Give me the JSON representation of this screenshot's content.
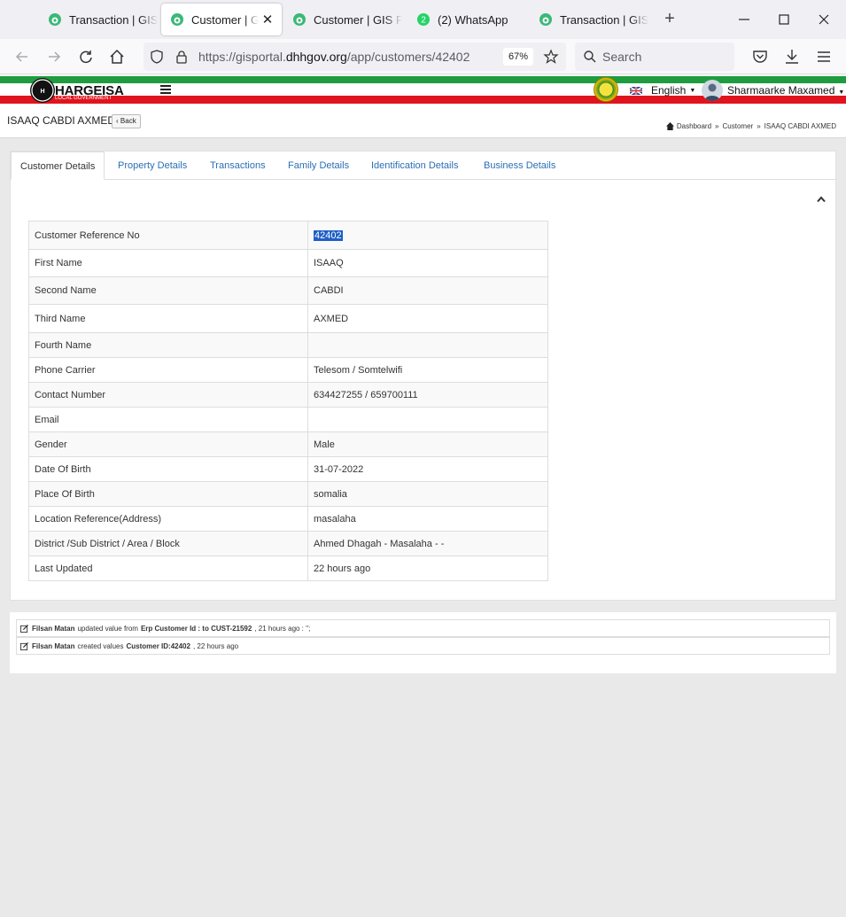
{
  "browser": {
    "tabs": [
      {
        "title": "Transaction | GIS P"
      },
      {
        "title": "Customer | GIS"
      },
      {
        "title": "Customer | GIS Po"
      },
      {
        "title": "(2) WhatsApp",
        "badge": "2"
      },
      {
        "title": "Transaction | GIS P"
      }
    ],
    "url_prefix": "https://gisportal.",
    "url_domain": "dhhgov.org",
    "url_path": "/app/customers/42402",
    "zoom": "67%",
    "search_placeholder": "Search"
  },
  "app": {
    "brand": "HARGEISA",
    "brand_sub": "LOCAL GOVERNMENT",
    "language": "English",
    "user_name": "Sharmaarke Maxamed"
  },
  "page": {
    "title": "ISAAQ CABDI AXMED",
    "back_label": "Back",
    "breadcrumb": [
      "Dashboard",
      "Customer",
      "ISAAQ CABDI AXMED"
    ]
  },
  "tabs": [
    "Customer Details",
    "Property Details",
    "Transactions",
    "Family Details",
    "Identification Details",
    "Business Details"
  ],
  "details": [
    {
      "label": "Customer Reference No",
      "value": "42402"
    },
    {
      "label": "First Name",
      "value": "ISAAQ"
    },
    {
      "label": "Second Name",
      "value": "CABDI"
    },
    {
      "label": "Third Name",
      "value": "AXMED"
    },
    {
      "label": "Fourth Name",
      "value": ""
    },
    {
      "label": "Phone Carrier",
      "value": "Telesom / Somtelwifi"
    },
    {
      "label": "Contact Number",
      "value": "634427255 / 659700111"
    },
    {
      "label": "Email",
      "value": ""
    },
    {
      "label": "Gender",
      "value": "Male"
    },
    {
      "label": "Date Of Birth",
      "value": "31-07-2022"
    },
    {
      "label": "Place Of Birth",
      "value": "somalia"
    },
    {
      "label": "Location Reference(Address)",
      "value": "masalaha"
    },
    {
      "label": "District /Sub District / Area / Block",
      "value": "Ahmed Dhagah - Masalaha - -"
    },
    {
      "label": "Last Updated",
      "value": "22 hours ago"
    }
  ],
  "logs": [
    {
      "user": "Filsan Matan",
      "action": "updated value from",
      "detail": "Erp Customer Id : to CUST-21592",
      "time": ", 21 hours ago : '';"
    },
    {
      "user": "Filsan Matan",
      "action": "created values",
      "detail": "Customer ID:42402",
      "time": ", 22 hours ago"
    }
  ]
}
